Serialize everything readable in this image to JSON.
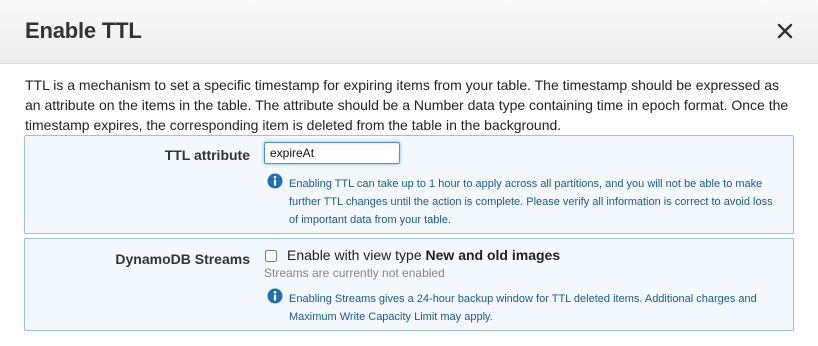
{
  "dialog": {
    "title": "Enable TTL",
    "close_icon": "close-icon",
    "description": "TTL is a mechanism to set a specific timestamp for expiring items from your table. The timestamp should be expressed as an attribute on the items in the table. The attribute should be a Number data type containing time in epoch format. Once the timestamp expires, the corresponding item is deleted from the table in the background."
  },
  "ttl": {
    "label": "TTL attribute",
    "value": "expireAt",
    "info_icon": "info-icon",
    "info": "Enabling TTL can take up to 1 hour to apply across all partitions, and you will not be able to make further TTL changes until the action is complete. Please verify all information is correct to avoid loss of important data from your table."
  },
  "streams": {
    "label": "DynamoDB Streams",
    "checkbox_prefix": "Enable with view type ",
    "checkbox_view_type": "New and old images",
    "checked": false,
    "status": "Streams are currently not enabled",
    "info_icon": "info-icon",
    "info": "Enabling Streams gives a 24-hour backup window for TTL deleted items. Additional charges and Maximum Write Capacity Limit may apply."
  },
  "colors": {
    "panel_bg": "#f2f8fc",
    "panel_border": "#9dc2dc",
    "info_text": "#1a5a96",
    "info_icon": "#1f6fb5",
    "focus": "#4a90e2"
  }
}
